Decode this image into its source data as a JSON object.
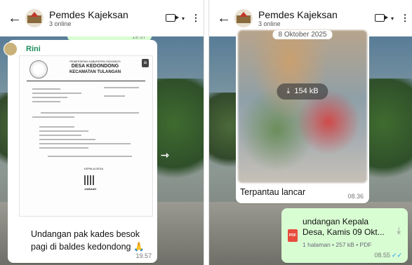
{
  "header": {
    "group_name": "Pemdes Kajeksan",
    "online": "3 online",
    "back_icon": "arrow-left-icon",
    "call_icon": "video-call-icon"
  },
  "left": {
    "prev_time": "19.57",
    "sender": "Rini",
    "letterhead": {
      "line1": "PEMERINTAH KABUPATEN SIDOARJO",
      "line2": "DESA KEDONDONG",
      "line3": "KECAMATAN TULANGAN"
    },
    "signature_title": "KEPALA DESA",
    "signature_name": "JAMAAH",
    "caption": "Undangan pak kades besok pagi di baldes kedondong 🙏",
    "time": "19.57"
  },
  "right": {
    "date_pill": "8 Oktober 2025",
    "download_size": "154 kB",
    "image_caption": "Terpantau lancar",
    "image_time": "08.36",
    "doc_name": "undangan Kepala Desa, Kamis 09 Okt...",
    "doc_meta": "1 halaman • 257 kB • PDF",
    "doc_time": "08.55"
  }
}
